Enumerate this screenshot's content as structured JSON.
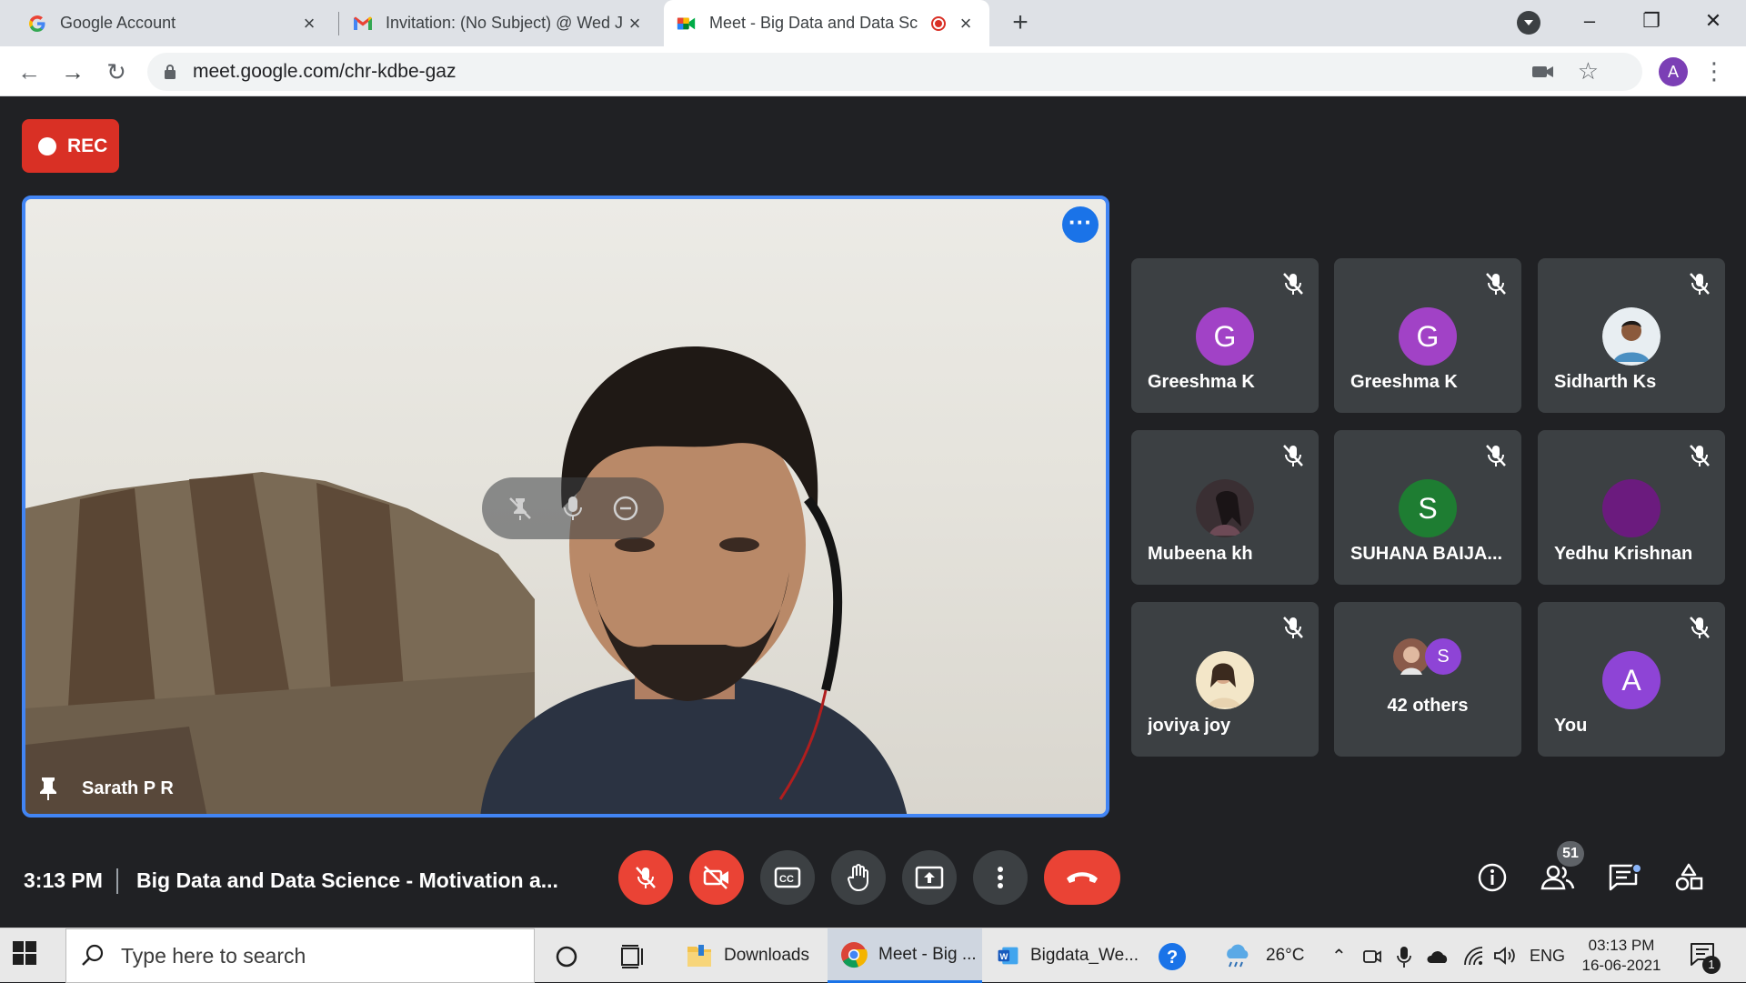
{
  "browser": {
    "tabs": [
      {
        "title": "Google Account",
        "favicon": "google-g-icon",
        "active": false
      },
      {
        "title": "Invitation: (No Subject) @ Wed Ju",
        "favicon": "gmail-icon",
        "active": false
      },
      {
        "title": "Meet - Big Data and Data Sc",
        "favicon": "meet-icon",
        "active": true,
        "recording": true
      }
    ],
    "url": "meet.google.com/chr-kdbe-gaz",
    "profile_initial": "A"
  },
  "meet": {
    "rec_label": "REC",
    "main_speaker": "Sarath P R",
    "participants": [
      {
        "name": "Greeshma K",
        "initial": "G",
        "color": "#a142c6",
        "muted": true
      },
      {
        "name": "Greeshma K",
        "initial": "G",
        "color": "#a142c6",
        "muted": true
      },
      {
        "name": "Sidharth Ks",
        "photo": true,
        "muted": true
      },
      {
        "name": "Mubeena kh",
        "photo": true,
        "muted": true
      },
      {
        "name": "SUHANA BAIJA...",
        "initial": "S",
        "color": "#1e7d32",
        "muted": true
      },
      {
        "name": "Yedhu Krishnan",
        "initial": "",
        "color": "#6b1b7e",
        "muted": true
      },
      {
        "name": "joviya joy",
        "photo": true,
        "muted": true
      },
      {
        "name": "42 others",
        "initial": "S",
        "color": "#8e44d6",
        "muted": false
      },
      {
        "name": "You",
        "initial": "A",
        "color": "#8e44d6",
        "muted": true
      }
    ],
    "time": "3:13 PM",
    "meeting_title": "Big Data and Data Science - Motivation a...",
    "people_count": "51",
    "accent_color": "#4285f4",
    "end_call_color": "#ea4335"
  },
  "taskbar": {
    "search_placeholder": "Type here to search",
    "apps": [
      {
        "label": "Downloads",
        "icon": "folder-icon"
      },
      {
        "label": "Meet - Big ...",
        "icon": "chrome-icon"
      },
      {
        "label": "Bigdata_We...",
        "icon": "word-icon"
      }
    ],
    "weather": "26°C",
    "language": "ENG",
    "clock_time": "03:13 PM",
    "clock_date": "16-06-2021",
    "notification_count": "1"
  }
}
